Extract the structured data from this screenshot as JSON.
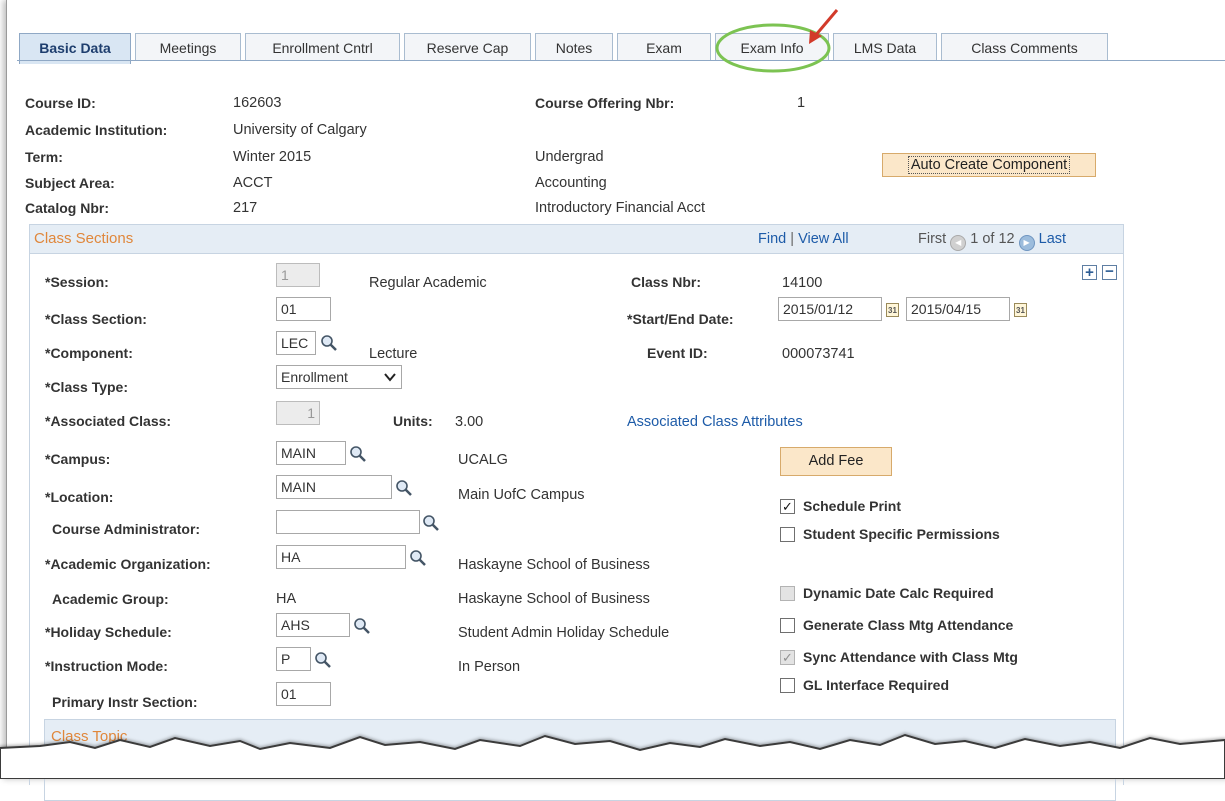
{
  "tabs": [
    {
      "label": "Basic Data",
      "active": true
    },
    {
      "label": "Meetings"
    },
    {
      "label": "Enrollment Cntrl"
    },
    {
      "label": "Reserve Cap"
    },
    {
      "label": "Notes"
    },
    {
      "label": "Exam"
    },
    {
      "label": "Exam Info",
      "highlighted": true
    },
    {
      "label": "LMS Data"
    },
    {
      "label": "Class Comments"
    }
  ],
  "header": {
    "course_id_label": "Course ID:",
    "course_id": "162603",
    "offering_label": "Course Offering Nbr:",
    "offering": "1",
    "institution_label": "Academic Institution:",
    "institution": "University of Calgary",
    "term_label": "Term:",
    "term": "Winter 2015",
    "career": "Undergrad",
    "subject_label": "Subject Area:",
    "subject": "ACCT",
    "subject_desc": "Accounting",
    "catalog_label": "Catalog Nbr:",
    "catalog": "217",
    "catalog_desc": "Introductory Financial Acct",
    "auto_create_button": "Auto Create Component"
  },
  "class_sections": {
    "title": "Class Sections",
    "find": "Find",
    "separator": "|",
    "view_all": "View All",
    "first": "First",
    "pager": "1 of 12",
    "last": "Last",
    "session_label": "*Session:",
    "session": "1",
    "session_desc": "Regular Academic",
    "class_nbr_label": "Class Nbr:",
    "class_nbr": "14100",
    "section_label": "*Class Section:",
    "section": "01",
    "dates_label": "*Start/End Date:",
    "start_date": "2015/01/12",
    "end_date": "2015/04/15",
    "component_label": "*Component:",
    "component": "LEC",
    "component_desc": "Lecture",
    "event_label": "Event ID:",
    "event_id": "000073741",
    "class_type_label": "*Class Type:",
    "class_type": "Enrollment",
    "assoc_label": "*Associated Class:",
    "assoc": "1",
    "units_label": "Units:",
    "units": "3.00",
    "assoc_attr_link": "Associated Class Attributes",
    "campus_label": "*Campus:",
    "campus": "MAIN",
    "campus_desc": "UCALG",
    "add_fee_button": "Add Fee",
    "location_label": "*Location:",
    "location": "MAIN",
    "location_desc": "Main UofC Campus",
    "course_admin_label": "Course Administrator:",
    "course_admin": "",
    "acad_org_label": "*Academic Organization:",
    "acad_org": "HA",
    "acad_org_desc": "Haskayne School of Business",
    "acad_group_label": "Academic Group:",
    "acad_group": "HA",
    "acad_group_desc": "Haskayne School of Business",
    "holiday_label": "*Holiday Schedule:",
    "holiday": "AHS",
    "holiday_desc": "Student Admin Holiday Schedule",
    "instr_mode_label": "*Instruction Mode:",
    "instr_mode": "P",
    "instr_mode_desc": "In Person",
    "primary_label": "Primary Instr Section:",
    "primary": "01",
    "checkboxes": [
      {
        "label": "Schedule Print",
        "checked": true,
        "disabled": false
      },
      {
        "label": "Student Specific Permissions",
        "checked": false,
        "disabled": false
      },
      {
        "label": "Dynamic Date Calc Required",
        "checked": false,
        "disabled": true
      },
      {
        "label": "Generate Class Mtg Attendance",
        "checked": false,
        "disabled": false
      },
      {
        "label": "Sync Attendance with Class Mtg",
        "checked": true,
        "disabled": true
      },
      {
        "label": "GL Interface Required",
        "checked": false,
        "disabled": false
      }
    ]
  },
  "class_topic": {
    "title": "Class Topic"
  },
  "colors": {
    "accent_orange": "#e0873b",
    "highlight_green": "#7cc352",
    "arrow_red": "#d23a2a",
    "link_blue": "#1d5ba8"
  },
  "icons": [
    "lookup-magnifier-icon",
    "calendar-icon",
    "add-row-icon",
    "delete-row-icon",
    "previous-icon",
    "next-icon",
    "dropdown-chevron-icon"
  ]
}
